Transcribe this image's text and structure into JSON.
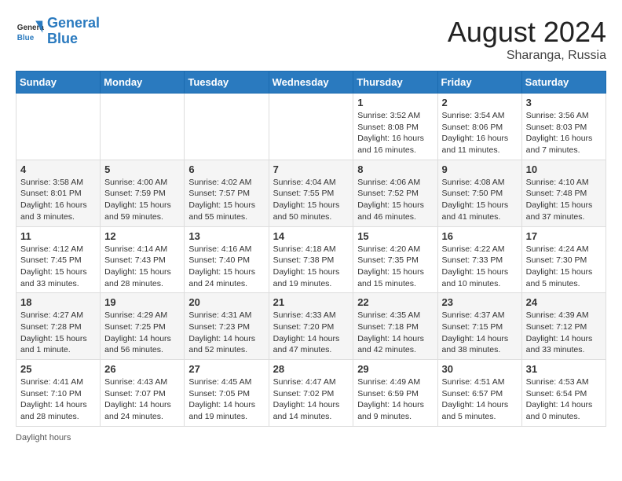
{
  "header": {
    "logo_line1": "General",
    "logo_line2": "Blue",
    "month": "August 2024",
    "location": "Sharanga, Russia"
  },
  "days_of_week": [
    "Sunday",
    "Monday",
    "Tuesday",
    "Wednesday",
    "Thursday",
    "Friday",
    "Saturday"
  ],
  "weeks": [
    [
      {
        "day": "",
        "info": ""
      },
      {
        "day": "",
        "info": ""
      },
      {
        "day": "",
        "info": ""
      },
      {
        "day": "",
        "info": ""
      },
      {
        "day": "1",
        "info": "Sunrise: 3:52 AM\nSunset: 8:08 PM\nDaylight: 16 hours and 16 minutes."
      },
      {
        "day": "2",
        "info": "Sunrise: 3:54 AM\nSunset: 8:06 PM\nDaylight: 16 hours and 11 minutes."
      },
      {
        "day": "3",
        "info": "Sunrise: 3:56 AM\nSunset: 8:03 PM\nDaylight: 16 hours and 7 minutes."
      }
    ],
    [
      {
        "day": "4",
        "info": "Sunrise: 3:58 AM\nSunset: 8:01 PM\nDaylight: 16 hours and 3 minutes."
      },
      {
        "day": "5",
        "info": "Sunrise: 4:00 AM\nSunset: 7:59 PM\nDaylight: 15 hours and 59 minutes."
      },
      {
        "day": "6",
        "info": "Sunrise: 4:02 AM\nSunset: 7:57 PM\nDaylight: 15 hours and 55 minutes."
      },
      {
        "day": "7",
        "info": "Sunrise: 4:04 AM\nSunset: 7:55 PM\nDaylight: 15 hours and 50 minutes."
      },
      {
        "day": "8",
        "info": "Sunrise: 4:06 AM\nSunset: 7:52 PM\nDaylight: 15 hours and 46 minutes."
      },
      {
        "day": "9",
        "info": "Sunrise: 4:08 AM\nSunset: 7:50 PM\nDaylight: 15 hours and 41 minutes."
      },
      {
        "day": "10",
        "info": "Sunrise: 4:10 AM\nSunset: 7:48 PM\nDaylight: 15 hours and 37 minutes."
      }
    ],
    [
      {
        "day": "11",
        "info": "Sunrise: 4:12 AM\nSunset: 7:45 PM\nDaylight: 15 hours and 33 minutes."
      },
      {
        "day": "12",
        "info": "Sunrise: 4:14 AM\nSunset: 7:43 PM\nDaylight: 15 hours and 28 minutes."
      },
      {
        "day": "13",
        "info": "Sunrise: 4:16 AM\nSunset: 7:40 PM\nDaylight: 15 hours and 24 minutes."
      },
      {
        "day": "14",
        "info": "Sunrise: 4:18 AM\nSunset: 7:38 PM\nDaylight: 15 hours and 19 minutes."
      },
      {
        "day": "15",
        "info": "Sunrise: 4:20 AM\nSunset: 7:35 PM\nDaylight: 15 hours and 15 minutes."
      },
      {
        "day": "16",
        "info": "Sunrise: 4:22 AM\nSunset: 7:33 PM\nDaylight: 15 hours and 10 minutes."
      },
      {
        "day": "17",
        "info": "Sunrise: 4:24 AM\nSunset: 7:30 PM\nDaylight: 15 hours and 5 minutes."
      }
    ],
    [
      {
        "day": "18",
        "info": "Sunrise: 4:27 AM\nSunset: 7:28 PM\nDaylight: 15 hours and 1 minute."
      },
      {
        "day": "19",
        "info": "Sunrise: 4:29 AM\nSunset: 7:25 PM\nDaylight: 14 hours and 56 minutes."
      },
      {
        "day": "20",
        "info": "Sunrise: 4:31 AM\nSunset: 7:23 PM\nDaylight: 14 hours and 52 minutes."
      },
      {
        "day": "21",
        "info": "Sunrise: 4:33 AM\nSunset: 7:20 PM\nDaylight: 14 hours and 47 minutes."
      },
      {
        "day": "22",
        "info": "Sunrise: 4:35 AM\nSunset: 7:18 PM\nDaylight: 14 hours and 42 minutes."
      },
      {
        "day": "23",
        "info": "Sunrise: 4:37 AM\nSunset: 7:15 PM\nDaylight: 14 hours and 38 minutes."
      },
      {
        "day": "24",
        "info": "Sunrise: 4:39 AM\nSunset: 7:12 PM\nDaylight: 14 hours and 33 minutes."
      }
    ],
    [
      {
        "day": "25",
        "info": "Sunrise: 4:41 AM\nSunset: 7:10 PM\nDaylight: 14 hours and 28 minutes."
      },
      {
        "day": "26",
        "info": "Sunrise: 4:43 AM\nSunset: 7:07 PM\nDaylight: 14 hours and 24 minutes."
      },
      {
        "day": "27",
        "info": "Sunrise: 4:45 AM\nSunset: 7:05 PM\nDaylight: 14 hours and 19 minutes."
      },
      {
        "day": "28",
        "info": "Sunrise: 4:47 AM\nSunset: 7:02 PM\nDaylight: 14 hours and 14 minutes."
      },
      {
        "day": "29",
        "info": "Sunrise: 4:49 AM\nSunset: 6:59 PM\nDaylight: 14 hours and 9 minutes."
      },
      {
        "day": "30",
        "info": "Sunrise: 4:51 AM\nSunset: 6:57 PM\nDaylight: 14 hours and 5 minutes."
      },
      {
        "day": "31",
        "info": "Sunrise: 4:53 AM\nSunset: 6:54 PM\nDaylight: 14 hours and 0 minutes."
      }
    ]
  ],
  "footer": {
    "daylight_label": "Daylight hours"
  }
}
